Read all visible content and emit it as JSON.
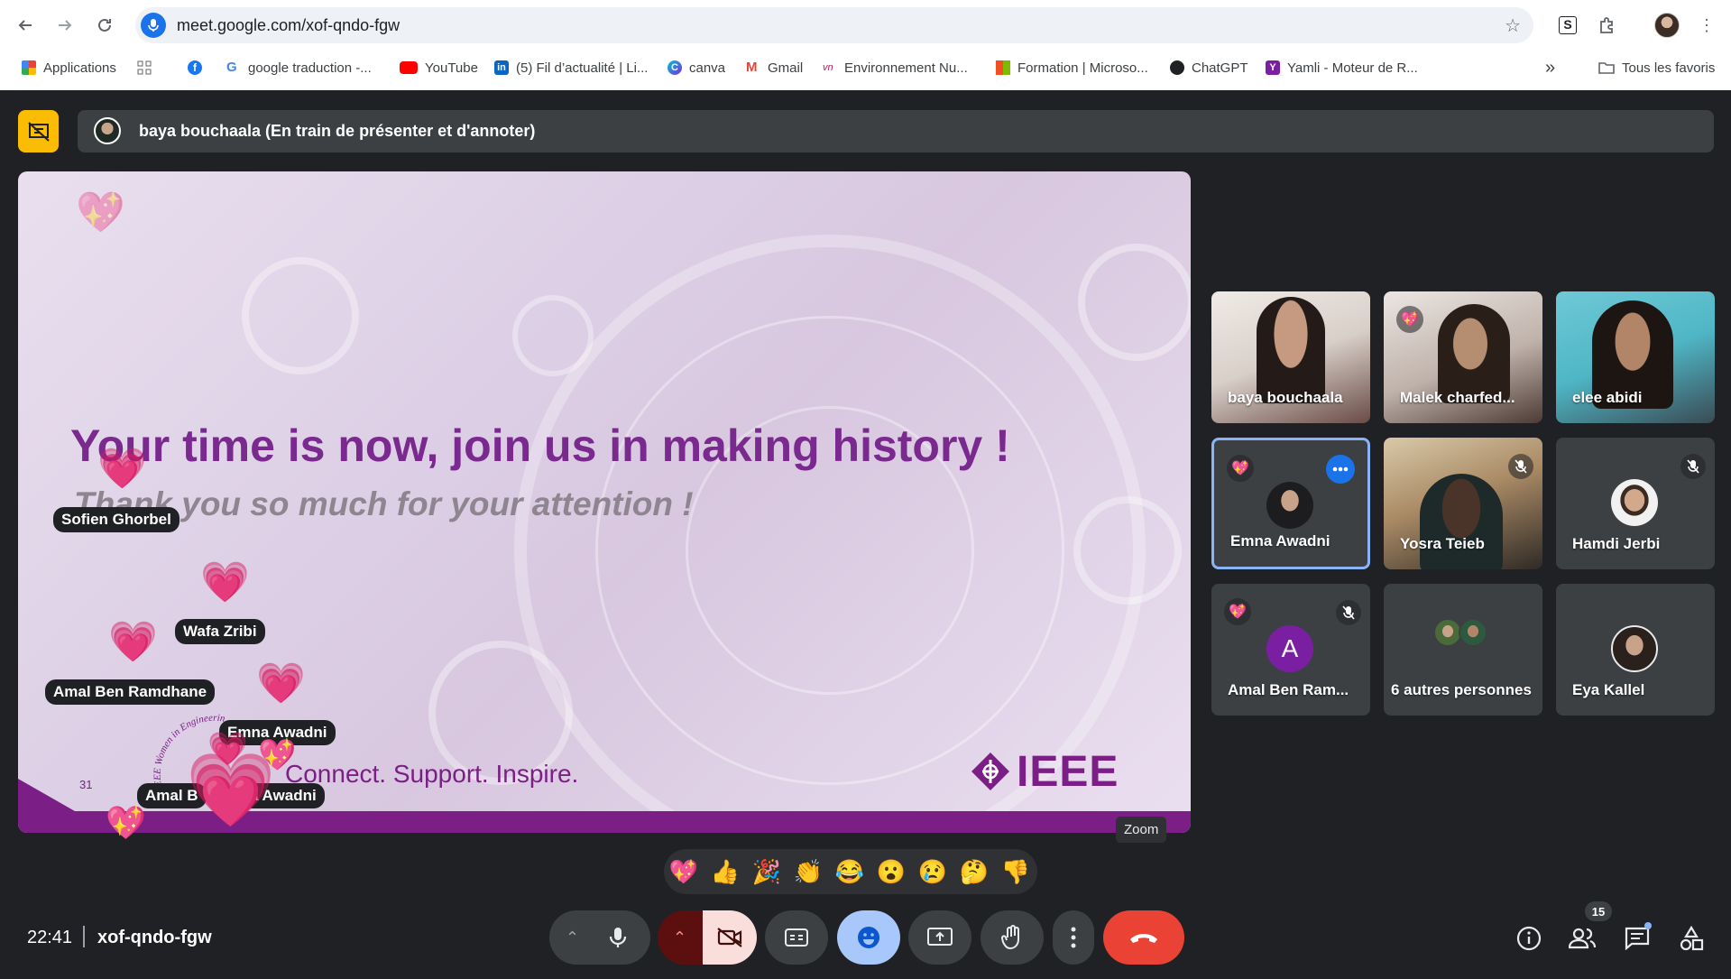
{
  "browser": {
    "url": "meet.google.com/xof-qndo-fgw",
    "bookmarks": [
      {
        "label": "Applications",
        "color": "#ea4335"
      },
      {
        "label": "",
        "color": "#5f6368"
      },
      {
        "label": "",
        "color": "#1877f2"
      },
      {
        "label": "google traduction -...",
        "color": "#4285f4"
      },
      {
        "label": "YouTube",
        "color": "#ff0000"
      },
      {
        "label": "(5) Fil d’actualité | Li...",
        "color": "#0a66c2"
      },
      {
        "label": "canva",
        "color": "#00c4cc"
      },
      {
        "label": "Gmail",
        "color": "#ea4335"
      },
      {
        "label": "Environnement Nu...",
        "color": "#c2185b"
      },
      {
        "label": "Formation | Microso...",
        "color": "#f25022"
      },
      {
        "label": "ChatGPT",
        "color": "#202124"
      },
      {
        "label": "Yamli - Moteur de R...",
        "color": "#7b1fa2"
      }
    ],
    "overflow_label": "»",
    "all_bookmarks_label": "Tous les favoris"
  },
  "presenter": {
    "text": "baya bouchaala (En train de présenter et d'annoter)"
  },
  "slide": {
    "title": "Your time is now, join us in making history !",
    "subtitle": "Thank you so much for your attention !",
    "tagline": "Connect. Support. Inspire.",
    "page_number": "31",
    "logo_text": "IEEE",
    "wie_text": "IEEE Women in Engineering"
  },
  "reaction_overlays": [
    {
      "name": "Sofien Ghorbel"
    },
    {
      "name": "Wafa Zribi"
    },
    {
      "name": "Amal Ben Ramdhane"
    },
    {
      "name": "Emna Awadni"
    },
    {
      "name": "Amal B"
    },
    {
      "name": "a Awadni"
    }
  ],
  "zoom_tooltip": "Zoom",
  "participants": [
    {
      "name": "baya bouchaala"
    },
    {
      "name": "Malek charfed..."
    },
    {
      "name": "elee abidi"
    },
    {
      "name": "Emna Awadni"
    },
    {
      "name": "Yosra Teieb"
    },
    {
      "name": "Hamdi Jerbi"
    },
    {
      "name": "Amal Ben Ram...",
      "initial": "A"
    },
    {
      "name": "6 autres personnes"
    },
    {
      "name": "Eya Kallel"
    }
  ],
  "reactions": [
    "💖",
    "👍",
    "🎉",
    "👏",
    "😂",
    "😮",
    "😢",
    "🤔",
    "👎"
  ],
  "meeting": {
    "time": "22:41",
    "code": "xof-qndo-fgw",
    "people_count": "15"
  },
  "colors": {
    "accent": "#8ab4f8",
    "end_call": "#ea4335",
    "presenting_badge": "#fbbc04",
    "slide_purple": "#7b1f86"
  }
}
